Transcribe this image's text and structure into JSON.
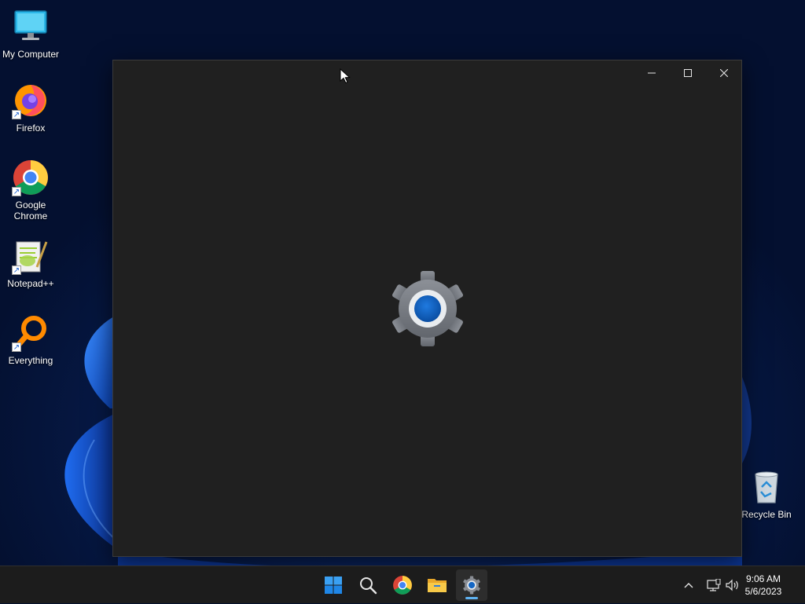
{
  "desktop": {
    "icons": [
      {
        "label": "My Computer",
        "icon": "monitor-icon"
      },
      {
        "label": "Firefox",
        "icon": "firefox-icon",
        "shortcut": true
      },
      {
        "label": "Google Chrome",
        "icon": "chrome-icon",
        "shortcut": true
      },
      {
        "label": "Notepad++",
        "icon": "notepadpp-icon",
        "shortcut": true
      },
      {
        "label": "Everything",
        "icon": "everything-icon",
        "shortcut": true
      },
      {
        "label": "Recycle Bin",
        "icon": "recycle-bin-icon"
      }
    ]
  },
  "window": {
    "app": "Settings",
    "state": "loading",
    "splash_icon": "settings-gear-icon",
    "controls": [
      "minimize-icon",
      "maximize-icon",
      "close-icon"
    ]
  },
  "taskbar": {
    "apps": [
      {
        "name": "start",
        "icon": "windows-start-icon"
      },
      {
        "name": "search",
        "icon": "search-icon"
      },
      {
        "name": "chrome",
        "icon": "chrome-icon"
      },
      {
        "name": "file-explorer",
        "icon": "folder-icon"
      },
      {
        "name": "settings",
        "icon": "settings-gear-icon",
        "active": true
      }
    ],
    "tray": [
      "chevron-up-icon",
      "network-icon",
      "volume-icon"
    ],
    "clock": {
      "time": "9:06 AM",
      "date": "5/6/2023"
    }
  },
  "colors": {
    "window_bg": "#202020",
    "taskbar_bg": "#1c1c1c",
    "accent": "#5fb2f2",
    "gear_gray": "#7b7f86",
    "gear_blue": "#0f5fb8"
  }
}
